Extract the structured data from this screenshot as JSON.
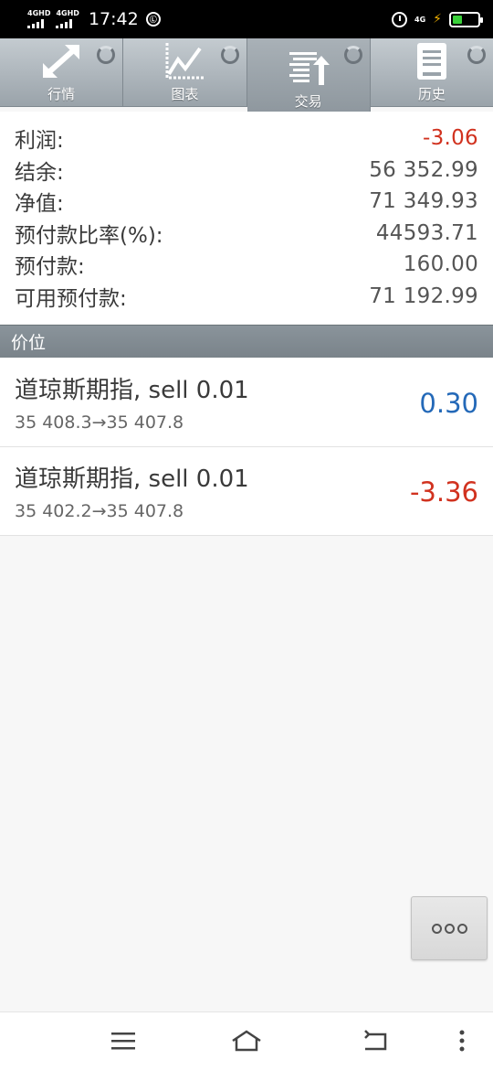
{
  "status_bar": {
    "network_left_1": "4GHD",
    "network_left_2": "4GHD",
    "time": "17:42",
    "network_right": "4G"
  },
  "tabs": [
    {
      "label": "行情",
      "icon": "quotes-arrows-icon",
      "active": false
    },
    {
      "label": "图表",
      "icon": "chart-line-icon",
      "active": false
    },
    {
      "label": "交易",
      "icon": "trade-list-icon",
      "active": true
    },
    {
      "label": "历史",
      "icon": "history-document-icon",
      "active": false
    }
  ],
  "summary": [
    {
      "label": "利润:",
      "value": "-3.06",
      "negative": true
    },
    {
      "label": "结余:",
      "value": "56 352.99",
      "negative": false
    },
    {
      "label": "净值:",
      "value": "71 349.93",
      "negative": false
    },
    {
      "label": "预付款比率(%):",
      "value": "44593.71",
      "negative": false
    },
    {
      "label": "预付款:",
      "value": "160.00",
      "negative": false
    },
    {
      "label": "可用预付款:",
      "value": "71 192.99",
      "negative": false
    }
  ],
  "section_header": "价位",
  "positions": [
    {
      "title": "道琼斯期指, sell 0.01",
      "prices": "35 408.3→35 407.8",
      "profit": "0.30",
      "profit_color": "#2469b8"
    },
    {
      "title": "道琼斯期指, sell 0.01",
      "prices": "35 402.2→35 407.8",
      "profit": "-3.36",
      "profit_color": "#d1321f"
    }
  ],
  "more_button_icon": "more-dots-icon",
  "nav_icons": [
    "menu-icon",
    "home-icon",
    "back-icon",
    "more-vertical-icon"
  ]
}
